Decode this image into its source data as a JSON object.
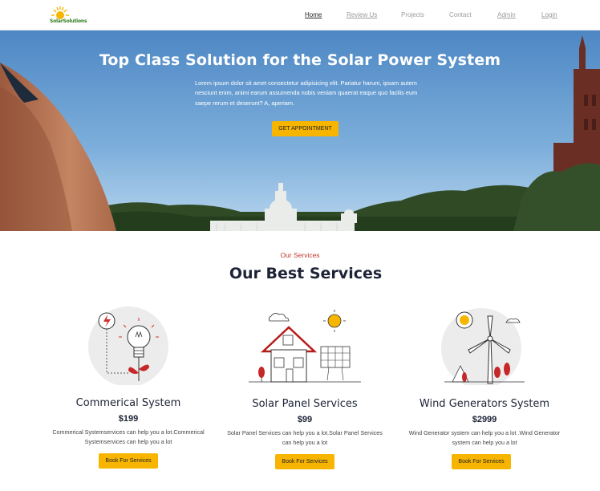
{
  "brand": {
    "logo_text": "SolarSolutions"
  },
  "nav": {
    "items": [
      {
        "label": "Home"
      },
      {
        "label": "Review Us"
      },
      {
        "label": "Projects"
      },
      {
        "label": "Contact"
      },
      {
        "label": "Admin"
      },
      {
        "label": "Login"
      }
    ]
  },
  "hero": {
    "title": "Top Class Solution for the Solar Power System",
    "text": "Lorem ipsum dolor sit amet consectetur adipisicing elit. Pariatur harum, ipsam autem nesciunt enim, animi earum assumenda nobis veniam quaerat eaque quo facilis eum saepe rerum et deserunt? A, aperiam.",
    "button": "GET APPOINTMENT"
  },
  "services": {
    "kicker": "Our Services",
    "title": "Our Best Services",
    "cards": [
      {
        "title": "Commerical System",
        "price": "$199",
        "description": "Commerical Systemservices can help you a lot.Commerical Systemservices can help you a lot",
        "button": "Book For Services"
      },
      {
        "title": "Solar Panel Services",
        "price": "$99",
        "description": "Solar Panel Services can help you a lot.Solar Panel Services can help you a lot",
        "button": "Book For Services"
      },
      {
        "title": "Wind Generators System",
        "price": "$2999",
        "description": "Wind Generator system can help you a lot .Wind Generator system can help you a lot",
        "button": "Book For Services"
      }
    ]
  },
  "colors": {
    "accent": "#f7b500",
    "kicker": "#c0392b",
    "heading": "#1d2336"
  }
}
